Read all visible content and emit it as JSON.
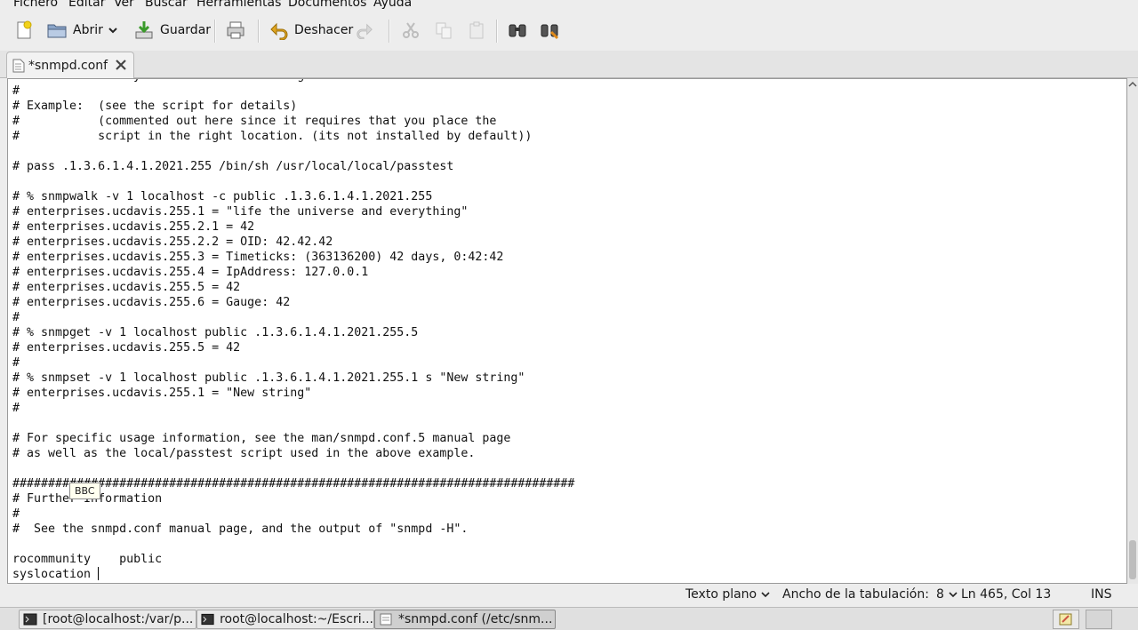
{
  "menu": [
    "Fichero",
    "Editar",
    "Ver",
    "Buscar",
    "Herramientas",
    "Documentos",
    "Ayuda"
  ],
  "toolbar": {
    "open_label": "Abrir",
    "save_label": "Guardar",
    "undo_label": "Deshacer"
  },
  "tab": {
    "title": "*snmpd.conf"
  },
  "editor": {
    "lines": [
      "# source directory or install it in the given location.",
      "#",
      "# Example:  (see the script for details)",
      "#           (commented out here since it requires that you place the",
      "#           script in the right location. (its not installed by default))",
      "",
      "# pass .1.3.6.1.4.1.2021.255 /bin/sh /usr/local/local/passtest",
      "",
      "# % snmpwalk -v 1 localhost -c public .1.3.6.1.4.1.2021.255",
      "# enterprises.ucdavis.255.1 = \"life the universe and everything\"",
      "# enterprises.ucdavis.255.2.1 = 42",
      "# enterprises.ucdavis.255.2.2 = OID: 42.42.42",
      "# enterprises.ucdavis.255.3 = Timeticks: (363136200) 42 days, 0:42:42",
      "# enterprises.ucdavis.255.4 = IpAddress: 127.0.0.1",
      "# enterprises.ucdavis.255.5 = 42",
      "# enterprises.ucdavis.255.6 = Gauge: 42",
      "#",
      "# % snmpget -v 1 localhost public .1.3.6.1.4.1.2021.255.5",
      "# enterprises.ucdavis.255.5 = 42",
      "#",
      "# % snmpset -v 1 localhost public .1.3.6.1.4.1.2021.255.1 s \"New string\"",
      "# enterprises.ucdavis.255.1 = \"New string\"",
      "#",
      "",
      "# For specific usage information, see the man/snmpd.conf.5 manual page",
      "# as well as the local/passtest script used in the above example.",
      "",
      "###############################################################################",
      "# Further Information",
      "#",
      "#  See the snmpd.conf manual page, and the output of \"snmpd -H\".",
      "",
      "rocommunity    public",
      "syslocation "
    ]
  },
  "tooltip": "BBC",
  "status": {
    "syntax": "Texto plano",
    "tab_width_label": "Ancho de la tabulación:",
    "tab_width_value": "8",
    "position": "Ln 465, Col 13",
    "mode": "INS"
  },
  "taskbar": {
    "items": [
      "[root@localhost:/var/p...",
      "root@localhost:~/Escri...",
      "*snmpd.conf (/etc/snm..."
    ]
  }
}
